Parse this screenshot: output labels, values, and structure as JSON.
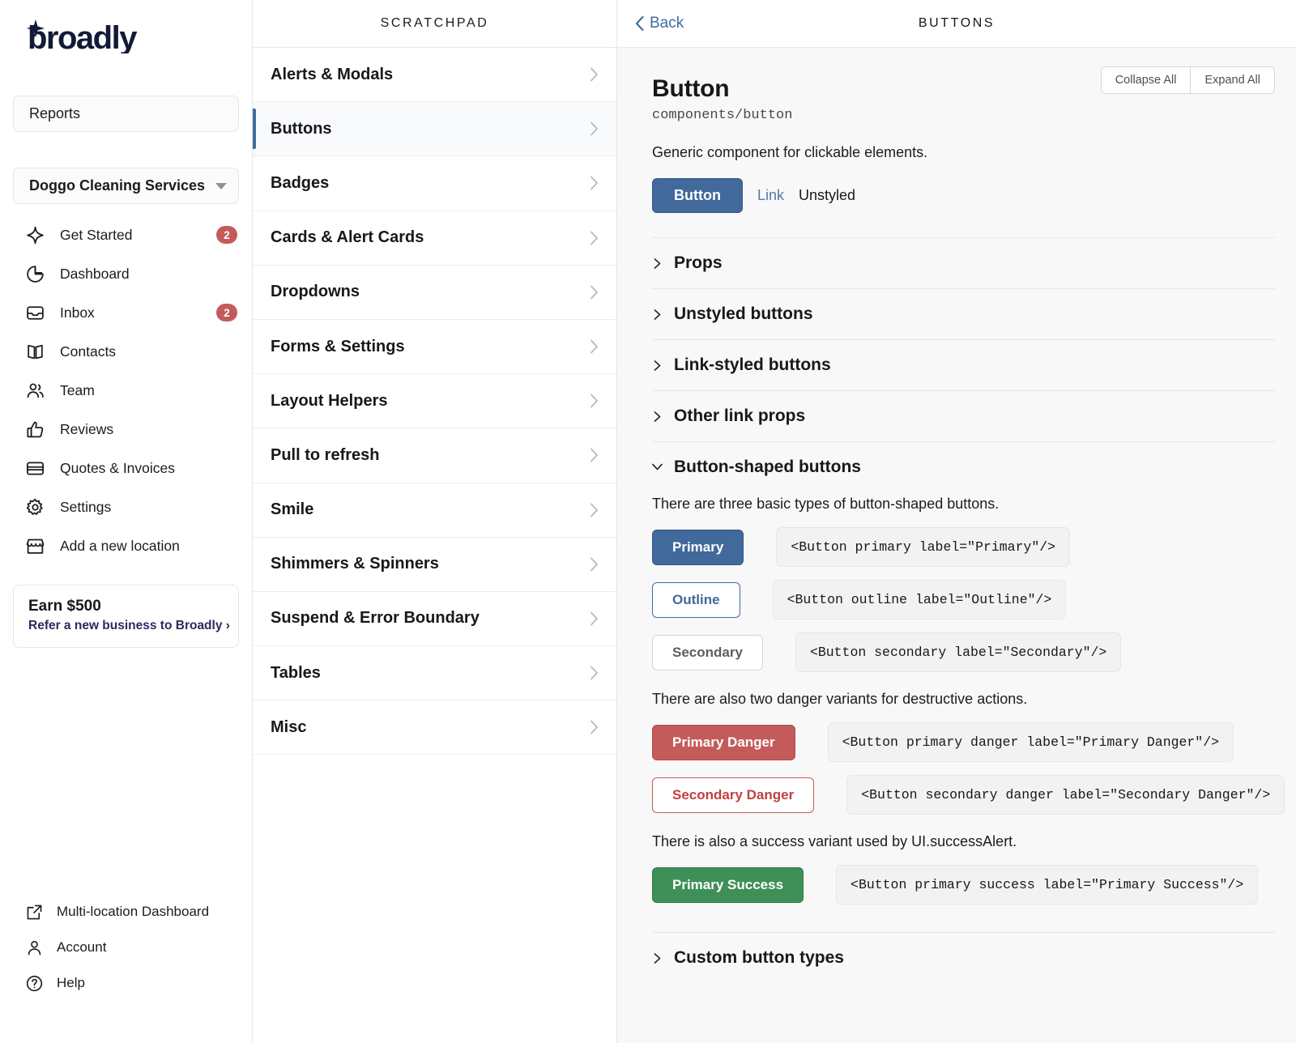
{
  "brand": {
    "name": "broadly"
  },
  "sidebar": {
    "reports_label": "Reports",
    "location": {
      "name": "Doggo Cleaning Services",
      "caret_icon": "chevron-down-icon"
    },
    "nav": [
      {
        "label": "Get Started",
        "icon": "sparkle-icon",
        "badge": "2"
      },
      {
        "label": "Dashboard",
        "icon": "pie-chart-icon",
        "badge": ""
      },
      {
        "label": "Inbox",
        "icon": "inbox-icon",
        "badge": "2"
      },
      {
        "label": "Contacts",
        "icon": "book-icon",
        "badge": ""
      },
      {
        "label": "Team",
        "icon": "users-icon",
        "badge": ""
      },
      {
        "label": "Reviews",
        "icon": "thumbs-up-icon",
        "badge": ""
      },
      {
        "label": "Quotes & Invoices",
        "icon": "card-icon",
        "badge": ""
      },
      {
        "label": "Settings",
        "icon": "gear-icon",
        "badge": ""
      },
      {
        "label": "Add a new location",
        "icon": "storefront-icon",
        "badge": ""
      }
    ],
    "referral": {
      "title": "Earn $500",
      "link": "Refer a new business to Broadly ›"
    },
    "bottom": [
      {
        "label": "Multi-location Dashboard",
        "icon": "external-link-icon"
      },
      {
        "label": "Account",
        "icon": "person-icon"
      },
      {
        "label": "Help",
        "icon": "question-circle-icon"
      }
    ]
  },
  "scratchpad": {
    "header": "SCRATCHPAD",
    "items": [
      {
        "label": "Alerts & Modals",
        "active": false
      },
      {
        "label": "Buttons",
        "active": true
      },
      {
        "label": "Badges",
        "active": false
      },
      {
        "label": "Cards & Alert Cards",
        "active": false
      },
      {
        "label": "Dropdowns",
        "active": false
      },
      {
        "label": "Forms & Settings",
        "active": false
      },
      {
        "label": "Layout Helpers",
        "active": false
      },
      {
        "label": "Pull to refresh",
        "active": false
      },
      {
        "label": "Smile",
        "active": false
      },
      {
        "label": "Shimmers & Spinners",
        "active": false
      },
      {
        "label": "Suspend & Error Boundary",
        "active": false
      },
      {
        "label": "Tables",
        "active": false
      },
      {
        "label": "Misc",
        "active": false
      }
    ]
  },
  "main": {
    "back_label": "Back",
    "title": "BUTTONS",
    "collapse_all": "Collapse All",
    "expand_all": "Expand All",
    "doc_title": "Button",
    "doc_path": "components/button",
    "doc_desc": "Generic component for clickable elements.",
    "tabs": [
      {
        "label": "Button",
        "style": "primary"
      },
      {
        "label": "Link",
        "style": "link"
      },
      {
        "label": "Unstyled",
        "style": "plain"
      }
    ],
    "collapsed_sections": [
      {
        "label": "Props"
      },
      {
        "label": "Unstyled buttons"
      },
      {
        "label": "Link-styled buttons"
      },
      {
        "label": "Other link props"
      }
    ],
    "open_section": {
      "label": "Button-shaped buttons",
      "para_1": "There are three basic types of button-shaped buttons.",
      "examples_1": [
        {
          "label": "Primary",
          "variant": "btn-primary",
          "code": "<Button primary label=\"Primary\"/>"
        },
        {
          "label": "Outline",
          "variant": "btn-outline",
          "code": "<Button outline label=\"Outline\"/>"
        },
        {
          "label": "Secondary",
          "variant": "btn-secondary",
          "code": "<Button secondary label=\"Secondary\"/>"
        }
      ],
      "para_2": "There are also two danger variants for destructive actions.",
      "examples_2": [
        {
          "label": "Primary Danger",
          "variant": "btn-pdanger",
          "code": "<Button primary danger label=\"Primary Danger\"/>"
        },
        {
          "label": "Secondary Danger",
          "variant": "btn-sdanger",
          "code": "<Button secondary danger label=\"Secondary Danger\"/>"
        }
      ],
      "para_3": "There is also a success variant used by UI.successAlert.",
      "examples_3": [
        {
          "label": "Primary Success",
          "variant": "btn-psuccess",
          "code": "<Button primary success label=\"Primary Success\"/>"
        }
      ]
    },
    "trailing_section": {
      "label": "Custom button types"
    }
  },
  "colors": {
    "primary": "#41699b",
    "danger": "#c45b5b",
    "success": "#3f9058",
    "badge": "#c45b5b",
    "link": "#3f6d9b",
    "panel_bg": "#f8f8f8"
  }
}
